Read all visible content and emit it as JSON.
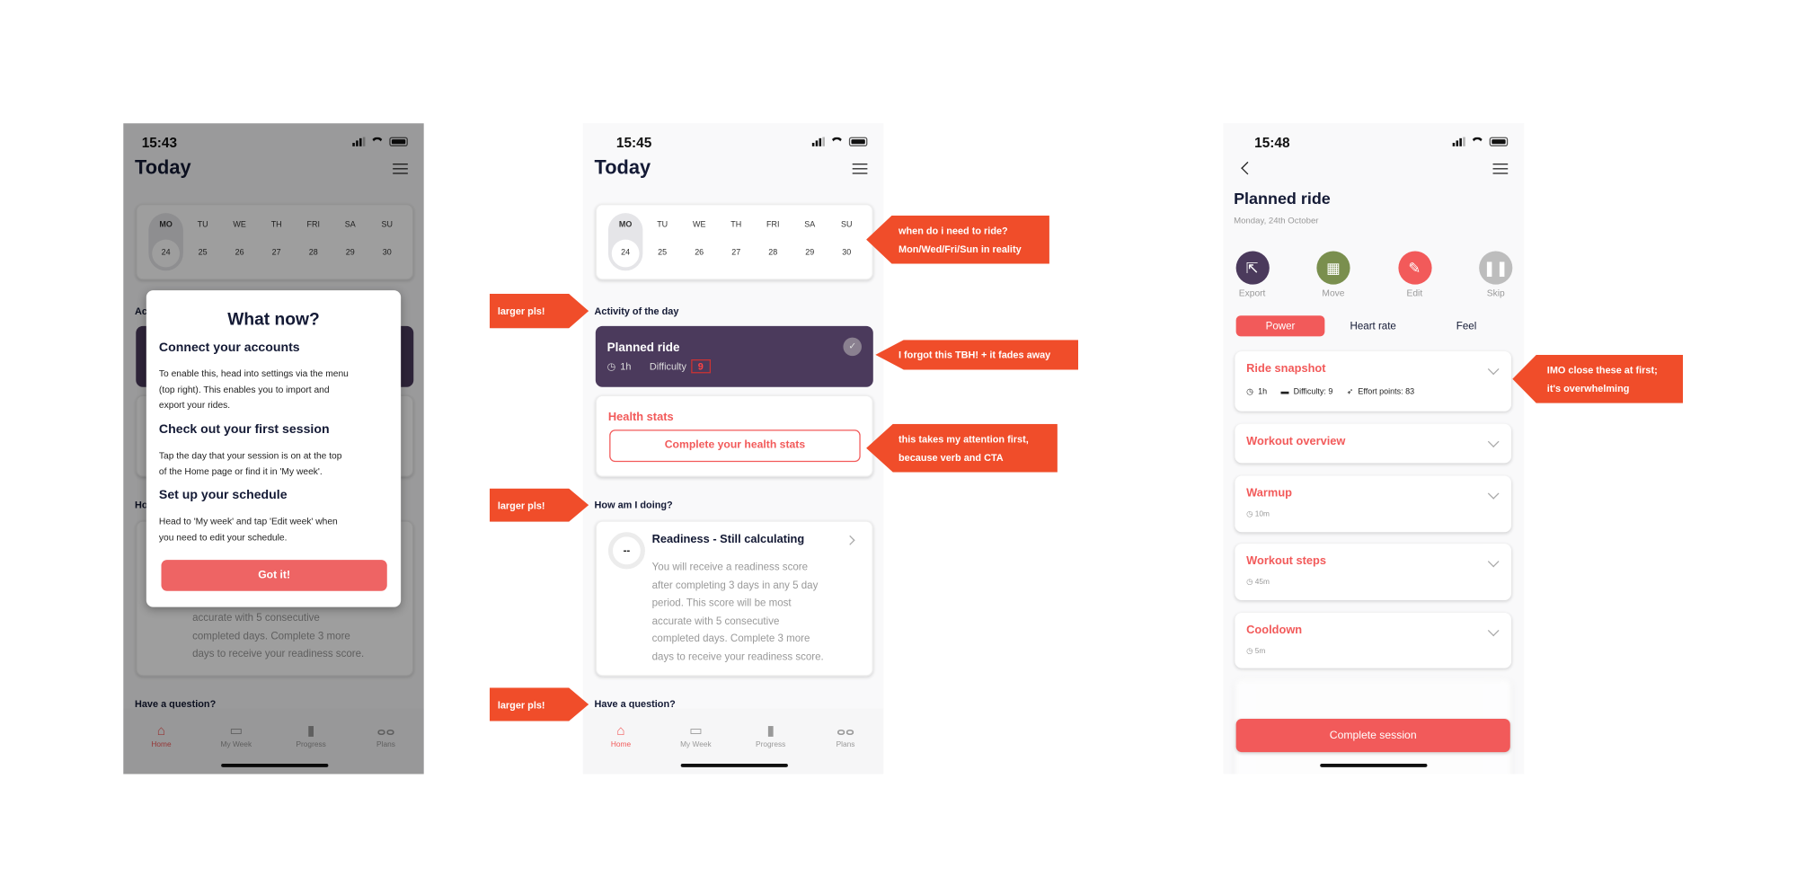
{
  "colors": {
    "accent": "#f25a5a",
    "ride_card": "#4b3a5c",
    "callout": "#f04d2a",
    "title": "#141a35",
    "move": "#7a8f4e",
    "export": "#4b3a5c",
    "skip": "#bdbdbd"
  },
  "calendar": {
    "days": [
      "MO",
      "TU",
      "WE",
      "TH",
      "FRI",
      "SA",
      "SU"
    ],
    "dates": [
      "24",
      "25",
      "26",
      "27",
      "28",
      "29",
      "30"
    ],
    "selected": "MO"
  },
  "status_icons": [
    "signal-icon",
    "wifi-icon",
    "battery-icon"
  ],
  "screen1": {
    "time": "15:43",
    "title": "Today",
    "section_partial_1": "Ac",
    "section_partial_2": "Ho",
    "readiness_partial": [
      "accurate with 5 consecutive",
      "completed days. Complete 3 more",
      "days to receive your readiness score."
    ],
    "question": "Have a question?",
    "modal": {
      "title": "What now?",
      "sections": [
        {
          "heading": "Connect your accounts",
          "body": [
            "To enable this, head into settings via the menu",
            "(top right). This enables you to import and",
            "export your rides."
          ]
        },
        {
          "heading": "Check out your first session",
          "body": [
            "Tap the day that your session is on at the top",
            "of the Home page or find it in 'My week'."
          ]
        },
        {
          "heading": "Set up your schedule",
          "body": [
            "Head to 'My week' and tap 'Edit week' when",
            "you need to edit your schedule."
          ]
        }
      ],
      "button": "Got it!"
    }
  },
  "screen2": {
    "time": "15:45",
    "title": "Today",
    "activity_heading": "Activity of the day",
    "ride": {
      "title": "Planned ride",
      "duration": "1h",
      "difficulty_label": "Difficulty",
      "difficulty": "9"
    },
    "health": {
      "title": "Health stats",
      "button": "Complete your health stats"
    },
    "doing_heading": "How am I doing?",
    "readiness": {
      "score": "--",
      "title": "Readiness - Still calculating",
      "body": [
        "You will receive a readiness score",
        "after completing 3 days in any 5 day",
        "period. This score will be most",
        "accurate with 5 consecutive",
        "completed days. Complete 3 more",
        "days to receive your readiness score."
      ]
    },
    "question": "Have a question?"
  },
  "nav": [
    {
      "label": "Home",
      "icon": "home-icon",
      "active": true
    },
    {
      "label": "My Week",
      "icon": "calendar-icon"
    },
    {
      "label": "Progress",
      "icon": "bar-chart-icon"
    },
    {
      "label": "Plans",
      "icon": "bicycle-icon"
    }
  ],
  "screen3": {
    "time": "15:48",
    "title": "Planned ride",
    "date": "Monday, 24th October",
    "actions": [
      {
        "label": "Export",
        "icon": "export-icon"
      },
      {
        "label": "Move",
        "icon": "calendar-icon"
      },
      {
        "label": "Edit",
        "icon": "pencil-icon"
      },
      {
        "label": "Skip",
        "icon": "pause-icon"
      }
    ],
    "tabs": [
      "Power",
      "Heart rate",
      "Feel"
    ],
    "active_tab": "Power",
    "snapshot": {
      "title": "Ride snapshot",
      "duration": "1h",
      "difficulty": "Difficulty: 9",
      "effort": "Effort points: 83"
    },
    "sections": [
      {
        "title": "Workout overview"
      },
      {
        "title": "Warmup",
        "meta": "10m"
      },
      {
        "title": "Workout steps",
        "meta": "45m"
      },
      {
        "title": "Cooldown",
        "meta": "5m"
      }
    ],
    "complete_button": "Complete session"
  },
  "annotations": {
    "calendar": [
      "when do i need to ride?",
      "Mon/Wed/Fri/Sun in reality"
    ],
    "larger": "larger pls!",
    "check": "I forgot this TBH! + it fades away",
    "health": [
      "this takes my attention first,",
      "because verb and CTA"
    ],
    "snapshot": [
      "IMO close these at first;",
      "it's overwhelming"
    ]
  }
}
